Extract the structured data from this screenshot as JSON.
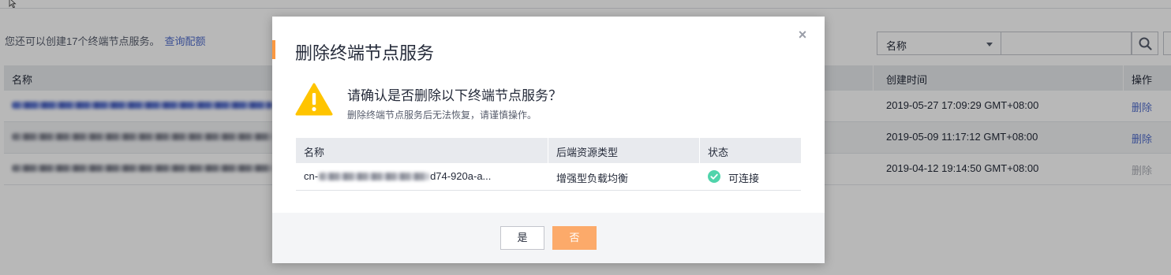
{
  "background": {
    "quota_text": "您还可以创建17个终端节点服务。",
    "quota_link": "查询配额",
    "search": {
      "field_label": "名称",
      "placeholder": ""
    },
    "table": {
      "headers": {
        "name": "名称",
        "created": "创建时间",
        "action": "操作"
      },
      "rows": [
        {
          "created": "2019-05-27 17:09:29 GMT+08:00",
          "action": "删除",
          "action_enabled": true
        },
        {
          "created": "2019-05-09 11:17:12 GMT+08:00",
          "action": "删除",
          "action_enabled": true
        },
        {
          "created": "2019-04-12 19:14:50 GMT+08:00",
          "action": "删除",
          "action_enabled": false
        }
      ]
    }
  },
  "dialog": {
    "title": "删除终端节点服务",
    "close_glyph": "×",
    "question": "请确认是否删除以下终端节点服务？",
    "subtext": "删除终端节点服务后无法恢复，请谨慎操作。",
    "table": {
      "headers": {
        "name": "名称",
        "backend_type": "后端资源类型",
        "status": "状态"
      },
      "row": {
        "name_prefix": "cn-",
        "name_suffix": "d74-920a-a...",
        "backend_type": "增强型负载均衡",
        "status": "可连接"
      }
    },
    "buttons": {
      "yes": "是",
      "no": "否"
    }
  },
  "colors": {
    "accent_orange": "#fa9841",
    "link_blue": "#526ecc",
    "warning_yellow": "#ffc400",
    "success_green": "#50d4ab",
    "primary_button": "#fcaa6a"
  },
  "icons": {
    "cursor": "arrow-cursor-icon",
    "search": "search-icon",
    "warning": "warning-icon",
    "status_ok": "check-circle-icon",
    "close": "close-icon",
    "caret": "caret-down-icon"
  }
}
